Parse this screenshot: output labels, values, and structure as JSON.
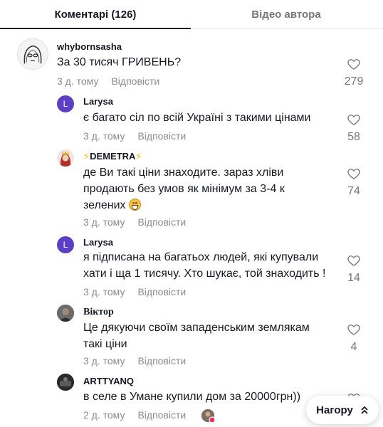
{
  "tabs": {
    "comments": "Коментарі (126)",
    "author_videos": "Відео автора"
  },
  "reply_label": "Відповісти",
  "comments": [
    {
      "user": "whybornsasha",
      "text": "За 30 тисяч ГРИВЕНЬ?",
      "time": "3 д. тому",
      "likes": "279"
    },
    {
      "user": "Larysa",
      "avatar_letter": "L",
      "text": "є багато сіл по всій Україні з такими цінами",
      "time": "3 д. тому",
      "likes": "58"
    },
    {
      "user": "DEMETRA",
      "text": "де Ви такі ціни знаходите. зараз хліви продають без умов як мінімум за 3-4 к зелених",
      "time": "3 д. тому",
      "likes": "74"
    },
    {
      "user": "Larysa",
      "avatar_letter": "L",
      "text": "я підписана на багатьох людей, які купували хати і ща 1 тисячу. Хто шукає, той знаходить !",
      "time": "3 д. тому",
      "likes": "14"
    },
    {
      "user": "Віктор",
      "text": "Це дякуючи своїм западенським землякам такі ціни",
      "time": "3 д. тому",
      "likes": "4"
    },
    {
      "user": "ARTTYANQ",
      "text": "в селе в Умане купили дом за 20000грн))",
      "time": "2 д. тому",
      "likes": ""
    }
  ],
  "scroll_top": {
    "label": "Нагору"
  },
  "colors": {
    "accent_avatar": "#5b3fc4",
    "muted": "#8a8b91",
    "text": "#161823"
  }
}
